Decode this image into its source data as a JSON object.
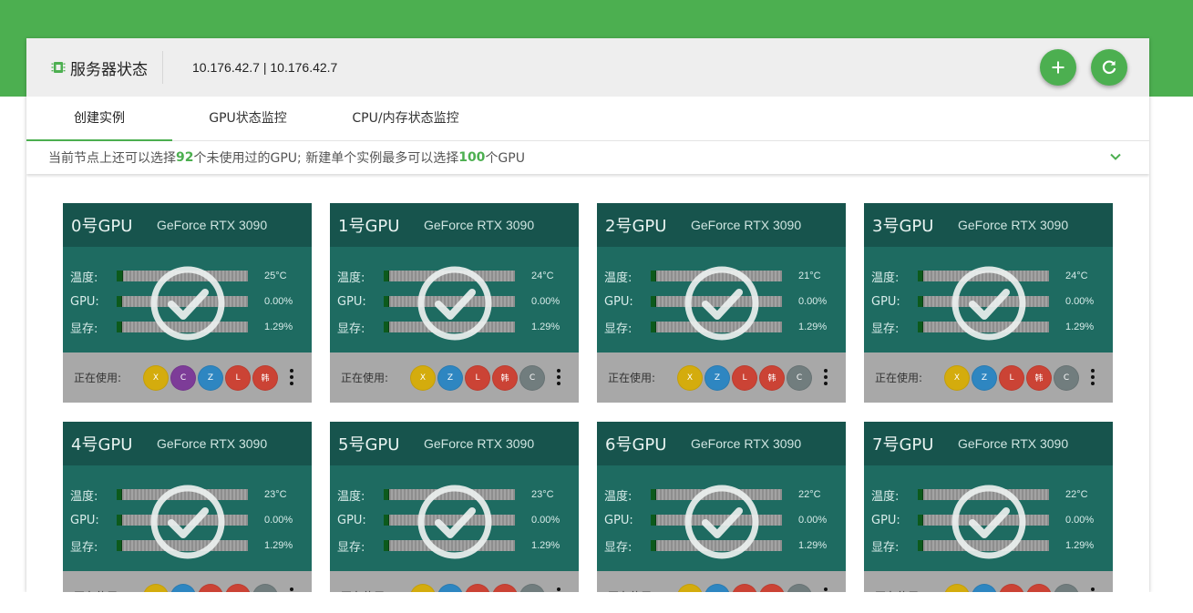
{
  "header": {
    "title": "服务器状态",
    "host": "10.176.42.7 | 10.176.42.7",
    "icon": "chip-icon",
    "add_icon": "plus-icon",
    "refresh_icon": "refresh-icon"
  },
  "tabs": [
    {
      "label": "创建实例",
      "active": true
    },
    {
      "label": "GPU状态监控",
      "active": false
    },
    {
      "label": "CPU/内存状态监控",
      "active": false
    }
  ],
  "notice": {
    "text1": "当前节点上还可以选择",
    "count1": "92",
    "text2": "个未使用过的GPU; 新建单个实例最多可以选择",
    "count2": "100",
    "text3": "个GPU"
  },
  "labels": {
    "temp": "温度:",
    "gpu": "GPU:",
    "mem": "显存:",
    "using": "正在使用:"
  },
  "colors": {
    "accent": "#4caf50",
    "card_bg": "#1e6b61",
    "card_head": "#17544d",
    "yellow": "#d4ac0d",
    "purple": "#7d3c98",
    "blue": "#2e86c1",
    "red": "#cb4335",
    "gray": "#717d7e"
  },
  "gpus": [
    {
      "title": "0号GPU",
      "model": "GeForce RTX 3090",
      "temp": "25°C",
      "temp_pct": 5,
      "util": "0.00%",
      "util_pct": 0,
      "mem": "1.29%",
      "mem_pct": 1.29,
      "users": [
        {
          "t": "X",
          "c": "yellow"
        },
        {
          "t": "C",
          "c": "purple"
        },
        {
          "t": "Z",
          "c": "blue"
        },
        {
          "t": "L",
          "c": "red"
        },
        {
          "t": "韩",
          "c": "red"
        }
      ]
    },
    {
      "title": "1号GPU",
      "model": "GeForce RTX 3090",
      "temp": "24°C",
      "temp_pct": 4,
      "util": "0.00%",
      "util_pct": 0,
      "mem": "1.29%",
      "mem_pct": 1.29,
      "users": [
        {
          "t": "X",
          "c": "yellow"
        },
        {
          "t": "Z",
          "c": "blue"
        },
        {
          "t": "L",
          "c": "red"
        },
        {
          "t": "韩",
          "c": "red"
        },
        {
          "t": "C",
          "c": "gray"
        }
      ]
    },
    {
      "title": "2号GPU",
      "model": "GeForce RTX 3090",
      "temp": "21°C",
      "temp_pct": 2,
      "util": "0.00%",
      "util_pct": 0,
      "mem": "1.29%",
      "mem_pct": 1.29,
      "users": [
        {
          "t": "X",
          "c": "yellow"
        },
        {
          "t": "Z",
          "c": "blue"
        },
        {
          "t": "L",
          "c": "red"
        },
        {
          "t": "韩",
          "c": "red"
        },
        {
          "t": "C",
          "c": "gray"
        }
      ]
    },
    {
      "title": "3号GPU",
      "model": "GeForce RTX 3090",
      "temp": "24°C",
      "temp_pct": 4,
      "util": "0.00%",
      "util_pct": 0,
      "mem": "1.29%",
      "mem_pct": 1.29,
      "users": [
        {
          "t": "X",
          "c": "yellow"
        },
        {
          "t": "Z",
          "c": "blue"
        },
        {
          "t": "L",
          "c": "red"
        },
        {
          "t": "韩",
          "c": "red"
        },
        {
          "t": "C",
          "c": "gray"
        }
      ]
    },
    {
      "title": "4号GPU",
      "model": "GeForce RTX 3090",
      "temp": "23°C",
      "temp_pct": 3,
      "util": "0.00%",
      "util_pct": 0,
      "mem": "1.29%",
      "mem_pct": 1.29,
      "users": [
        {
          "t": "",
          "c": "yellow"
        },
        {
          "t": "",
          "c": "blue"
        },
        {
          "t": "",
          "c": "red"
        },
        {
          "t": "",
          "c": "red"
        },
        {
          "t": "",
          "c": "gray"
        }
      ]
    },
    {
      "title": "5号GPU",
      "model": "GeForce RTX 3090",
      "temp": "23°C",
      "temp_pct": 3,
      "util": "0.00%",
      "util_pct": 0,
      "mem": "1.29%",
      "mem_pct": 1.29,
      "users": [
        {
          "t": "",
          "c": "yellow"
        },
        {
          "t": "",
          "c": "blue"
        },
        {
          "t": "",
          "c": "red"
        },
        {
          "t": "",
          "c": "red"
        },
        {
          "t": "",
          "c": "gray"
        }
      ]
    },
    {
      "title": "6号GPU",
      "model": "GeForce RTX 3090",
      "temp": "22°C",
      "temp_pct": 2.5,
      "util": "0.00%",
      "util_pct": 0,
      "mem": "1.29%",
      "mem_pct": 1.29,
      "users": [
        {
          "t": "",
          "c": "yellow"
        },
        {
          "t": "",
          "c": "blue"
        },
        {
          "t": "",
          "c": "red"
        },
        {
          "t": "",
          "c": "red"
        },
        {
          "t": "",
          "c": "gray"
        }
      ]
    },
    {
      "title": "7号GPU",
      "model": "GeForce RTX 3090",
      "temp": "22°C",
      "temp_pct": 2.5,
      "util": "0.00%",
      "util_pct": 0,
      "mem": "1.29%",
      "mem_pct": 1.29,
      "users": [
        {
          "t": "",
          "c": "yellow"
        },
        {
          "t": "",
          "c": "blue"
        },
        {
          "t": "",
          "c": "red"
        },
        {
          "t": "",
          "c": "red"
        },
        {
          "t": "",
          "c": "gray"
        }
      ]
    }
  ]
}
